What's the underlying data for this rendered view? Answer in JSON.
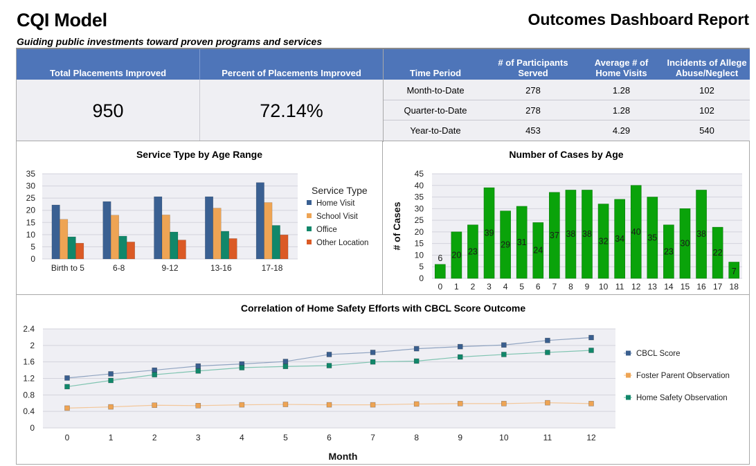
{
  "header": {
    "title": "CQI Model",
    "subtitle": "Guiding public investments toward proven programs and services",
    "report_title": "Outcomes Dashboard Report"
  },
  "kpis": [
    {
      "label": "Total Placements Improved",
      "value": "950"
    },
    {
      "label": "Percent of Placements Improved",
      "value": "72.14%"
    }
  ],
  "summary_table": {
    "columns": [
      "Time Period",
      "# of Participants Served",
      "Average # of Home Visits",
      "Incidents of Allege Abuse/Neglect"
    ],
    "column_lines": [
      [
        "Time Period"
      ],
      [
        "# of Participants",
        "Served"
      ],
      [
        "Average # of",
        "Home Visits"
      ],
      [
        "Incidents of Allege",
        "Abuse/Neglect"
      ]
    ],
    "rows": [
      [
        "Month-to-Date",
        "278",
        "1.28",
        "102"
      ],
      [
        "Quarter-to-Date",
        "278",
        "1.28",
        "102"
      ],
      [
        "Year-to-Date",
        "453",
        "4.29",
        "540"
      ]
    ]
  },
  "colors": {
    "header_blue": "#4e75b9",
    "home_visit": "#3a6092",
    "school_visit": "#eea454",
    "office": "#11876a",
    "other_location": "#db5a25",
    "cases_bar": "#0aa30a",
    "cbcl": "#3a5f8f",
    "foster": "#eea454",
    "home_safety": "#11876a",
    "plot_bg": "#efeff4",
    "grid": "#d3d3dc"
  },
  "chart_data": [
    {
      "id": "service-type",
      "type": "bar",
      "title": "Service Type by Age Range",
      "xlabel": "",
      "ylabel": "",
      "ylim": [
        0,
        35
      ],
      "yticks": [
        0,
        5,
        10,
        15,
        20,
        25,
        30,
        35
      ],
      "grid": true,
      "legend_title": "Service Type",
      "legend_position": "right",
      "categories": [
        "Birth to 5",
        "6-8",
        "9-12",
        "13-16",
        "17-18"
      ],
      "series": [
        {
          "name": "Home Visit",
          "values": [
            22.2,
            23.6,
            25.6,
            25.6,
            31.4
          ]
        },
        {
          "name": "School Visit",
          "values": [
            16.3,
            18.0,
            18.1,
            20.9,
            23.2
          ]
        },
        {
          "name": "Office",
          "values": [
            9.1,
            9.4,
            11.1,
            11.4,
            13.8
          ]
        },
        {
          "name": "Other Location",
          "values": [
            6.5,
            7.0,
            7.8,
            8.4,
            9.9
          ]
        }
      ]
    },
    {
      "id": "cases-by-age",
      "type": "bar",
      "title": "Number of Cases by Age",
      "xlabel": "",
      "ylabel": "# of Cases",
      "ylim": [
        0,
        45
      ],
      "yticks": [
        0,
        5,
        10,
        15,
        20,
        25,
        30,
        35,
        40,
        45
      ],
      "grid": true,
      "categories": [
        "0",
        "1",
        "2",
        "3",
        "4",
        "5",
        "6",
        "7",
        "8",
        "9",
        "10",
        "11",
        "12",
        "13",
        "14",
        "15",
        "16",
        "17",
        "18"
      ],
      "values": [
        6,
        20,
        23,
        39,
        29,
        31,
        24,
        37,
        38,
        38,
        32,
        34,
        40,
        35,
        23,
        30,
        38,
        22,
        7
      ],
      "data_labels": [
        "6",
        "20",
        "23",
        "39",
        "29",
        "31",
        "24",
        "37",
        "38",
        "38",
        "32",
        "34",
        "40",
        "35",
        "23",
        "30",
        "38",
        "22",
        "7"
      ]
    },
    {
      "id": "cbcl-correlation",
      "type": "line",
      "title": "Correlation of Home Safety Efforts with CBCL Score Outcome",
      "xlabel": "Month",
      "ylabel": "",
      "x": [
        0,
        1,
        2,
        3,
        4,
        5,
        6,
        7,
        8,
        9,
        10,
        11,
        12
      ],
      "xticks": [
        "0",
        "1",
        "2",
        "3",
        "4",
        "5",
        "6",
        "7",
        "8",
        "9",
        "10",
        "11",
        "12"
      ],
      "ylim": [
        0,
        2.4
      ],
      "yticks": [
        "0",
        "0.4",
        "0.8",
        "1.2",
        "1.6",
        "2",
        "2.4"
      ],
      "ytick_values": [
        0,
        0.4,
        0.8,
        1.2,
        1.6,
        2.0,
        2.4
      ],
      "grid": true,
      "legend_position": "right",
      "series": [
        {
          "name": "CBCL Score",
          "values": [
            1.21,
            1.31,
            1.4,
            1.5,
            1.55,
            1.61,
            1.78,
            1.83,
            1.92,
            1.97,
            2.01,
            2.12,
            2.19
          ]
        },
        {
          "name": "Foster Parent Observation",
          "values": [
            0.48,
            0.51,
            0.55,
            0.54,
            0.56,
            0.57,
            0.56,
            0.56,
            0.58,
            0.59,
            0.59,
            0.61,
            0.59
          ]
        },
        {
          "name": "Home Safety Observation",
          "values": [
            1.0,
            1.15,
            1.29,
            1.38,
            1.46,
            1.49,
            1.51,
            1.6,
            1.62,
            1.72,
            1.78,
            1.83,
            1.88
          ]
        }
      ]
    }
  ]
}
